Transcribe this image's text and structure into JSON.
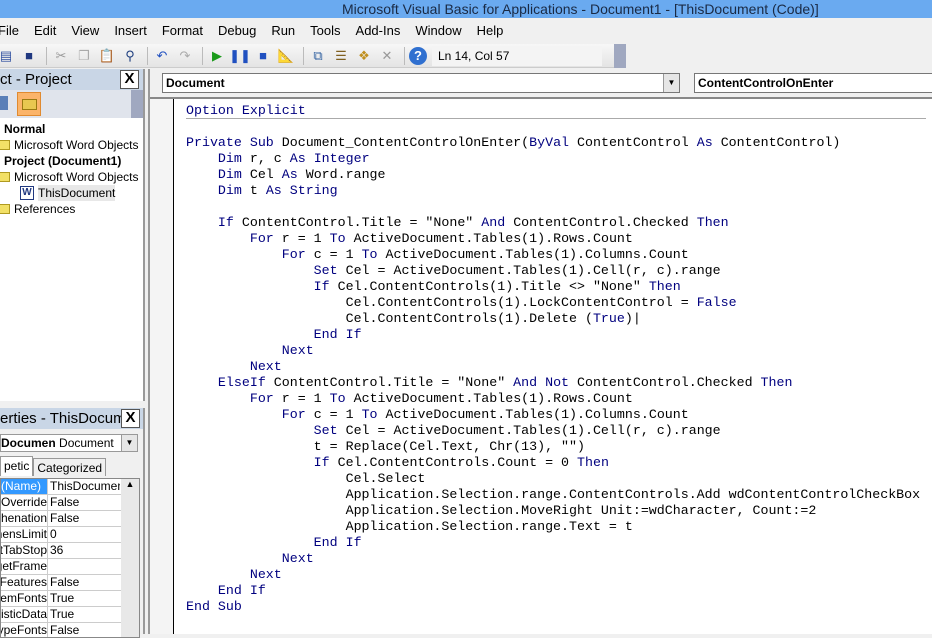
{
  "title": "Microsoft Visual Basic for Applications - Document1 - [ThisDocument (Code)]",
  "menu": [
    "File",
    "Edit",
    "View",
    "Insert",
    "Format",
    "Debug",
    "Run",
    "Tools",
    "Add-Ins",
    "Window",
    "Help"
  ],
  "toolbar": {
    "status": "Ln 14, Col 57",
    "icons": [
      "view-word-icon",
      "save-icon",
      "cut-icon",
      "copy-icon",
      "paste-icon",
      "find-icon",
      "undo-icon",
      "redo-icon",
      "run-icon",
      "break-icon",
      "reset-icon",
      "design-mode-icon",
      "project-explorer-icon",
      "properties-icon",
      "object-browser-icon",
      "toolbox-icon",
      "help-icon"
    ]
  },
  "project": {
    "title": "ct - Project",
    "close": "X",
    "tree": [
      {
        "label": "Normal",
        "bold": true,
        "level": 0
      },
      {
        "label": "Microsoft Word Objects",
        "level": 1,
        "icon": "folder"
      },
      {
        "label": "Project (Document1)",
        "bold": true,
        "level": 0
      },
      {
        "label": "Microsoft Word Objects",
        "level": 1,
        "icon": "folder-open"
      },
      {
        "label": "ThisDocument",
        "level": 2,
        "icon": "word-doc",
        "selected": true
      },
      {
        "label": "References",
        "level": 1,
        "icon": "folder"
      }
    ]
  },
  "properties": {
    "title": "erties - ThisDocume",
    "close": "X",
    "object_name": "Documen",
    "object_type": "Document",
    "tabs": [
      "petic",
      "Categorized"
    ],
    "rows": [
      [
        "(Name)",
        "ThisDocument"
      ],
      [
        "AutoFormatOverride",
        "False"
      ],
      [
        "AutoHyphenation",
        "False"
      ],
      [
        "ConsecutiveHyphensLimit",
        "0"
      ],
      [
        "DefaultTabStop",
        "36"
      ],
      [
        "DefaultTargetFrame",
        ""
      ],
      [
        "DisableFeatures",
        "False"
      ],
      [
        "DoNotEmbedSystemFonts",
        "True"
      ],
      [
        "EmbedLinguisticData",
        "True"
      ],
      [
        "EmbedTrueTypeFonts",
        "False"
      ]
    ]
  },
  "code": {
    "object": "Document",
    "procedure": "ContentControlOnEnter",
    "lines": [
      [
        [
          "k",
          "Option Explicit"
        ]
      ],
      [],
      [
        [
          "k",
          "Private Sub "
        ],
        [
          "t",
          "Document_ContentControlOnEnter("
        ],
        [
          "k",
          "ByVal "
        ],
        [
          "t",
          "ContentControl "
        ],
        [
          "k",
          "As "
        ],
        [
          "t",
          "ContentControl)"
        ]
      ],
      [
        [
          "t",
          "    "
        ],
        [
          "k",
          "Dim "
        ],
        [
          "t",
          "r, c "
        ],
        [
          "k",
          "As Integer"
        ]
      ],
      [
        [
          "t",
          "    "
        ],
        [
          "k",
          "Dim "
        ],
        [
          "t",
          "Cel "
        ],
        [
          "k",
          "As "
        ],
        [
          "t",
          "Word.range"
        ]
      ],
      [
        [
          "t",
          "    "
        ],
        [
          "k",
          "Dim "
        ],
        [
          "t",
          "t "
        ],
        [
          "k",
          "As String"
        ]
      ],
      [],
      [
        [
          "t",
          "    "
        ],
        [
          "k",
          "If "
        ],
        [
          "t",
          "ContentControl.Title = \"None\" "
        ],
        [
          "k",
          "And "
        ],
        [
          "t",
          "ContentControl.Checked "
        ],
        [
          "k",
          "Then"
        ]
      ],
      [
        [
          "t",
          "        "
        ],
        [
          "k",
          "For "
        ],
        [
          "t",
          "r = 1 "
        ],
        [
          "k",
          "To "
        ],
        [
          "t",
          "ActiveDocument.Tables(1).Rows.Count"
        ]
      ],
      [
        [
          "t",
          "            "
        ],
        [
          "k",
          "For "
        ],
        [
          "t",
          "c = 1 "
        ],
        [
          "k",
          "To "
        ],
        [
          "t",
          "ActiveDocument.Tables(1).Columns.Count"
        ]
      ],
      [
        [
          "t",
          "                "
        ],
        [
          "k",
          "Set "
        ],
        [
          "t",
          "Cel = ActiveDocument.Tables(1).Cell(r, c).range"
        ]
      ],
      [
        [
          "t",
          "                "
        ],
        [
          "k",
          "If "
        ],
        [
          "t",
          "Cel.ContentControls(1).Title <> \"None\" "
        ],
        [
          "k",
          "Then"
        ]
      ],
      [
        [
          "t",
          "                    Cel.ContentControls(1).LockContentControl = "
        ],
        [
          "k",
          "False"
        ]
      ],
      [
        [
          "t",
          "                    Cel.ContentControls(1).Delete ("
        ],
        [
          "k",
          "True"
        ],
        [
          "t",
          ")|"
        ]
      ],
      [
        [
          "t",
          "                "
        ],
        [
          "k",
          "End If"
        ]
      ],
      [
        [
          "t",
          "            "
        ],
        [
          "k",
          "Next"
        ]
      ],
      [
        [
          "t",
          "        "
        ],
        [
          "k",
          "Next"
        ]
      ],
      [
        [
          "t",
          "    "
        ],
        [
          "k",
          "ElseIf "
        ],
        [
          "t",
          "ContentControl.Title = \"None\" "
        ],
        [
          "k",
          "And Not "
        ],
        [
          "t",
          "ContentControl.Checked "
        ],
        [
          "k",
          "Then"
        ]
      ],
      [
        [
          "t",
          "        "
        ],
        [
          "k",
          "For "
        ],
        [
          "t",
          "r = 1 "
        ],
        [
          "k",
          "To "
        ],
        [
          "t",
          "ActiveDocument.Tables(1).Rows.Count"
        ]
      ],
      [
        [
          "t",
          "            "
        ],
        [
          "k",
          "For "
        ],
        [
          "t",
          "c = 1 "
        ],
        [
          "k",
          "To "
        ],
        [
          "t",
          "ActiveDocument.Tables(1).Columns.Count"
        ]
      ],
      [
        [
          "t",
          "                "
        ],
        [
          "k",
          "Set "
        ],
        [
          "t",
          "Cel = ActiveDocument.Tables(1).Cell(r, c).range"
        ]
      ],
      [
        [
          "t",
          "                t = Replace(Cel.Text, Chr(13), \"\")"
        ]
      ],
      [
        [
          "t",
          "                "
        ],
        [
          "k",
          "If "
        ],
        [
          "t",
          "Cel.ContentControls.Count = 0 "
        ],
        [
          "k",
          "Then"
        ]
      ],
      [
        [
          "t",
          "                    Cel.Select"
        ]
      ],
      [
        [
          "t",
          "                    Application.Selection.range.ContentControls.Add wdContentControlCheckBox"
        ]
      ],
      [
        [
          "t",
          "                    Application.Selection.MoveRight Unit:=wdCharacter, Count:=2"
        ]
      ],
      [
        [
          "t",
          "                    Application.Selection.range.Text = t"
        ]
      ],
      [
        [
          "t",
          "                "
        ],
        [
          "k",
          "End If"
        ]
      ],
      [
        [
          "t",
          "            "
        ],
        [
          "k",
          "Next"
        ]
      ],
      [
        [
          "t",
          "        "
        ],
        [
          "k",
          "Next"
        ]
      ],
      [
        [
          "t",
          "    "
        ],
        [
          "k",
          "End If"
        ]
      ],
      [
        [
          "k",
          "End Sub"
        ]
      ]
    ]
  },
  "colors": {
    "keyword": "#00007f",
    "titlebar": "#6aaaf0",
    "selection": "#3399ff"
  }
}
